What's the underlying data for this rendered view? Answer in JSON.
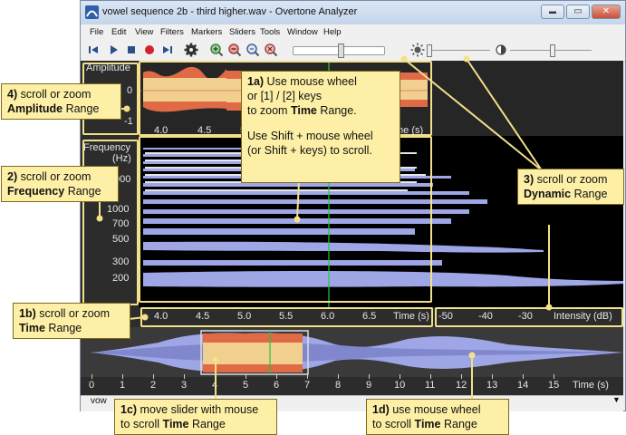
{
  "window": {
    "title": "vowel sequence 2b - third higher.wav - Overtone Analyzer",
    "buttons": {
      "minimize": "▬",
      "maximize": "▭",
      "close": "✕"
    }
  },
  "menu": [
    "File",
    "Edit",
    "View",
    "Filters",
    "Markers",
    "Sliders",
    "Tools",
    "Window",
    "Help"
  ],
  "toolbar": {
    "icons": [
      "skip-start-icon",
      "play-icon",
      "stop-icon",
      "record-icon",
      "skip-end-icon",
      "gear-icon",
      "zoom-in-icon",
      "zoom-out-icon",
      "zoom-fit-icon",
      "zoom-reset-icon",
      "brightness-icon",
      "contrast-icon"
    ]
  },
  "amplitude": {
    "label": "Amplitude",
    "ticks": [
      "0",
      "-1"
    ]
  },
  "frequency": {
    "label": "Frequency",
    "unit": "(Hz)",
    "ticks": [
      "000",
      "1000",
      "700",
      "500",
      "300",
      "200"
    ]
  },
  "time_axis_top": {
    "ticks": [
      "4.0",
      "4.5",
      "5"
    ],
    "unit": "me (s)"
  },
  "time_axis_main": {
    "ticks": [
      "4.0",
      "4.5",
      "5.0",
      "5.5",
      "6.0",
      "6.5"
    ],
    "unit": "Time (s)"
  },
  "intensity_axis": {
    "ticks": [
      "-50",
      "-40",
      "-30"
    ],
    "unit": "Intensity (dB)"
  },
  "overview_axis": {
    "ticks": [
      "0",
      "1",
      "2",
      "3",
      "4",
      "5",
      "6",
      "7",
      "8",
      "9",
      "10",
      "11",
      "12",
      "13",
      "14",
      "15"
    ],
    "unit": "Time (s)"
  },
  "status_tab": "vow",
  "callouts": {
    "c1a": {
      "bold": "1a)",
      "text": " Use mouse wheel",
      "line2": "or [1] / [2] keys",
      "line3_pre": "to zoom ",
      "line3_bold": "Time",
      "line3_post": " Range.",
      "line4": "Use Shift + mouse wheel",
      "line5": "(or Shift + keys) to scroll."
    },
    "c4": {
      "bold": "4)",
      "text": " scroll or zoom",
      "line2": "Amplitude",
      "line2_post": " Range"
    },
    "c2": {
      "bold": "2)",
      "text": " scroll or zoom",
      "line2": "Frequency",
      "line2_post": " Range"
    },
    "c3": {
      "bold": "3)",
      "text": " scroll or zoom",
      "line2": "Dynamic",
      "line2_post": " Range"
    },
    "c1b": {
      "bold": "1b)",
      "text": " scroll or zoom",
      "line2": "Time",
      "line2_post": " Range"
    },
    "c1c": {
      "bold": "1c)",
      "text": " move slider with mouse",
      "line2_pre": "to scroll ",
      "line2": "Time",
      "line2_post": " Range"
    },
    "c1d": {
      "bold": "1d)",
      "text": " use mouse wheel",
      "line2_pre": "to scroll ",
      "line2": "Time",
      "line2_post": " Range"
    }
  },
  "colors": {
    "waveform_outer": "#e06a46",
    "waveform_inner": "#f1cf8e",
    "spectrum": "#9ea6e6",
    "cursor": "#23c93a",
    "callout_fill": "#fdf0a6",
    "highlight": "#f2e08a"
  }
}
